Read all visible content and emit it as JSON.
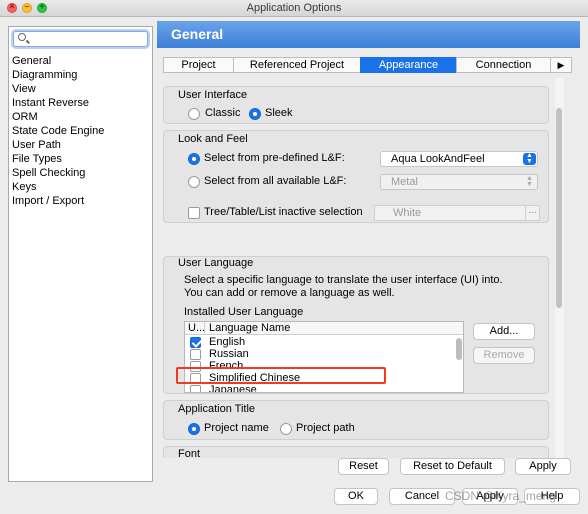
{
  "window": {
    "title": "Application Options"
  },
  "sidebar": {
    "search_placeholder": "",
    "items": [
      {
        "label": "General"
      },
      {
        "label": "Diagramming"
      },
      {
        "label": "View"
      },
      {
        "label": "Instant Reverse"
      },
      {
        "label": "ORM"
      },
      {
        "label": "State Code Engine"
      },
      {
        "label": "User Path"
      },
      {
        "label": "File Types"
      },
      {
        "label": "Spell Checking"
      },
      {
        "label": "Keys"
      },
      {
        "label": "Import / Export"
      }
    ]
  },
  "header": {
    "title": "General"
  },
  "tabs": [
    {
      "label": "Project",
      "active": false
    },
    {
      "label": "Referenced Project",
      "active": false
    },
    {
      "label": "Appearance",
      "active": true
    },
    {
      "label": "Connection",
      "active": false
    },
    {
      "label": "▶",
      "active": false
    }
  ],
  "user_interface": {
    "title": "User Interface",
    "classic": "Classic",
    "sleek": "Sleek",
    "selected": "Sleek"
  },
  "look_and_feel": {
    "title": "Look and Feel",
    "predefined_label": "Select from pre-defined L&F:",
    "predefined_value": "Aqua LookAndFeel",
    "all_label": "Select from all available L&F:",
    "all_value": "Metal",
    "inactive_label": "Tree/Table/List inactive selection",
    "inactive_value": "White",
    "dots": "..."
  },
  "user_language": {
    "title": "User Language",
    "description_line1": "Select a specific language to translate the user interface (UI) into.",
    "description_line2": "You can add or remove a language as well.",
    "installed_label": "Installed User Language",
    "col_use": "U...",
    "col_name": "Language Name",
    "languages": [
      {
        "name": "English",
        "checked": true
      },
      {
        "name": "Russian",
        "checked": false
      },
      {
        "name": "French",
        "checked": false
      },
      {
        "name": "Simplified Chinese",
        "checked": false
      },
      {
        "name": "Japanese",
        "checked": false
      }
    ],
    "add_button": "Add...",
    "remove_button": "Remove"
  },
  "application_title": {
    "title": "Application Title",
    "project_name": "Project name",
    "project_path": "Project path",
    "selected": "Project name"
  },
  "font_group": {
    "title": "Font"
  },
  "buttons": {
    "reset": "Reset",
    "reset_default": "Reset to Default",
    "apply": "Apply",
    "ok": "OK",
    "cancel": "Cancel",
    "apply_bottom": "Apply",
    "help": "Help"
  },
  "watermark": "CSDN @Kyra_meng"
}
